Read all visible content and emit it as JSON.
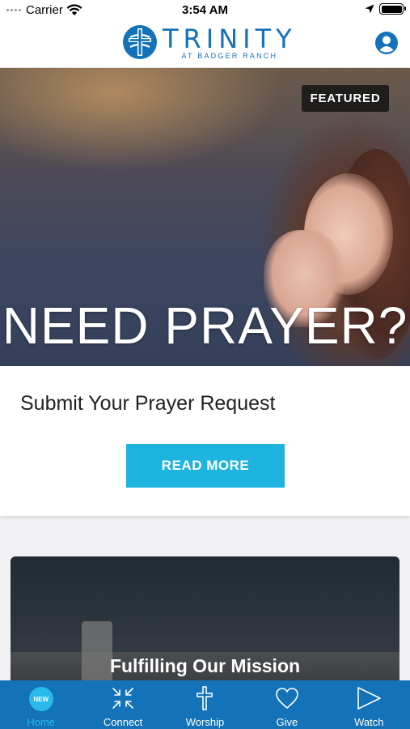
{
  "status_bar": {
    "carrier": "Carrier",
    "time": "3:54 AM"
  },
  "header": {
    "logo_main": "TRINITY",
    "logo_sub": "AT BADGER RANCH"
  },
  "featured": {
    "badge": "FEATURED",
    "headline": "NEED PRAYER?",
    "title": "Submit Your Prayer Request",
    "button_label": "READ MORE"
  },
  "mission_card": {
    "title": "Fulfilling Our Mission"
  },
  "tabs": [
    {
      "label": "Home",
      "badge": "NEW",
      "icon": "home-new-icon",
      "active": true
    },
    {
      "label": "Connect",
      "icon": "connect-arrows-icon",
      "active": false
    },
    {
      "label": "Worship",
      "icon": "cross-icon",
      "active": false
    },
    {
      "label": "Give",
      "icon": "heart-icon",
      "active": false
    },
    {
      "label": "Watch",
      "icon": "play-icon",
      "active": false
    }
  ],
  "colors": {
    "brand_blue": "#1372b8",
    "button_blue": "#1fb3e0",
    "active_tab": "#29b9ea"
  }
}
